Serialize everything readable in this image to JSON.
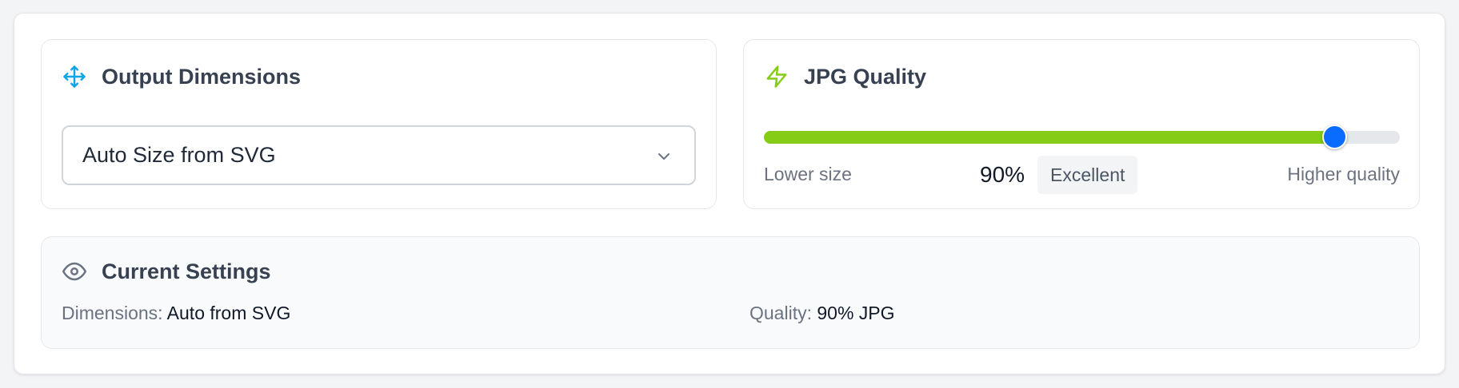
{
  "dimensions": {
    "title": "Output Dimensions",
    "icon": "move-arrows-icon",
    "select_value": "Auto Size from SVG"
  },
  "quality": {
    "title": "JPG Quality",
    "icon": "lightning-bolt-icon",
    "value_percent": 90,
    "value_label": "90%",
    "badge": "Excellent",
    "low_label": "Lower size",
    "high_label": "Higher quality"
  },
  "summary": {
    "title": "Current Settings",
    "icon": "eye-icon",
    "dimensions_label": "Dimensions:",
    "dimensions_value": "Auto from SVG",
    "quality_label": "Quality:",
    "quality_value": "90% JPG"
  },
  "colors": {
    "accent_blue": "#0ea5e9",
    "slider_fill": "#84cc16",
    "slider_thumb": "#0a6cff",
    "lime_icon": "#84cc16"
  }
}
